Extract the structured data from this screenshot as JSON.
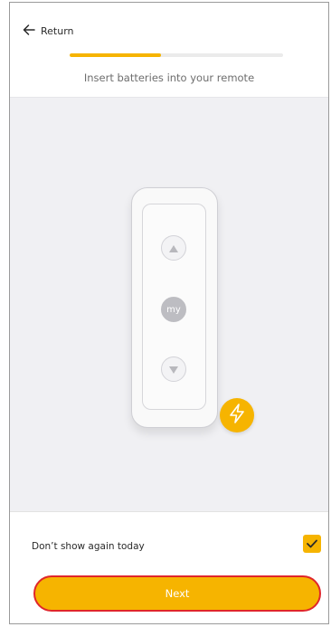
{
  "header": {
    "back_label": "Return",
    "back_icon": "arrow-left-icon",
    "progress_fraction": 0.43,
    "subtitle": "Insert batteries into your remote"
  },
  "remote": {
    "up_icon": "triangle-up-icon",
    "my_label": "my",
    "down_icon": "triangle-down-icon",
    "badge_icon": "lightning-bolt-icon"
  },
  "footer": {
    "dont_show_label": "Don’t show again today",
    "dont_show_checked": true,
    "next_label": "Next"
  },
  "colors": {
    "accent": "#f6b400",
    "highlight_border": "#e0262a",
    "stage_background": "#f0f0f3"
  }
}
